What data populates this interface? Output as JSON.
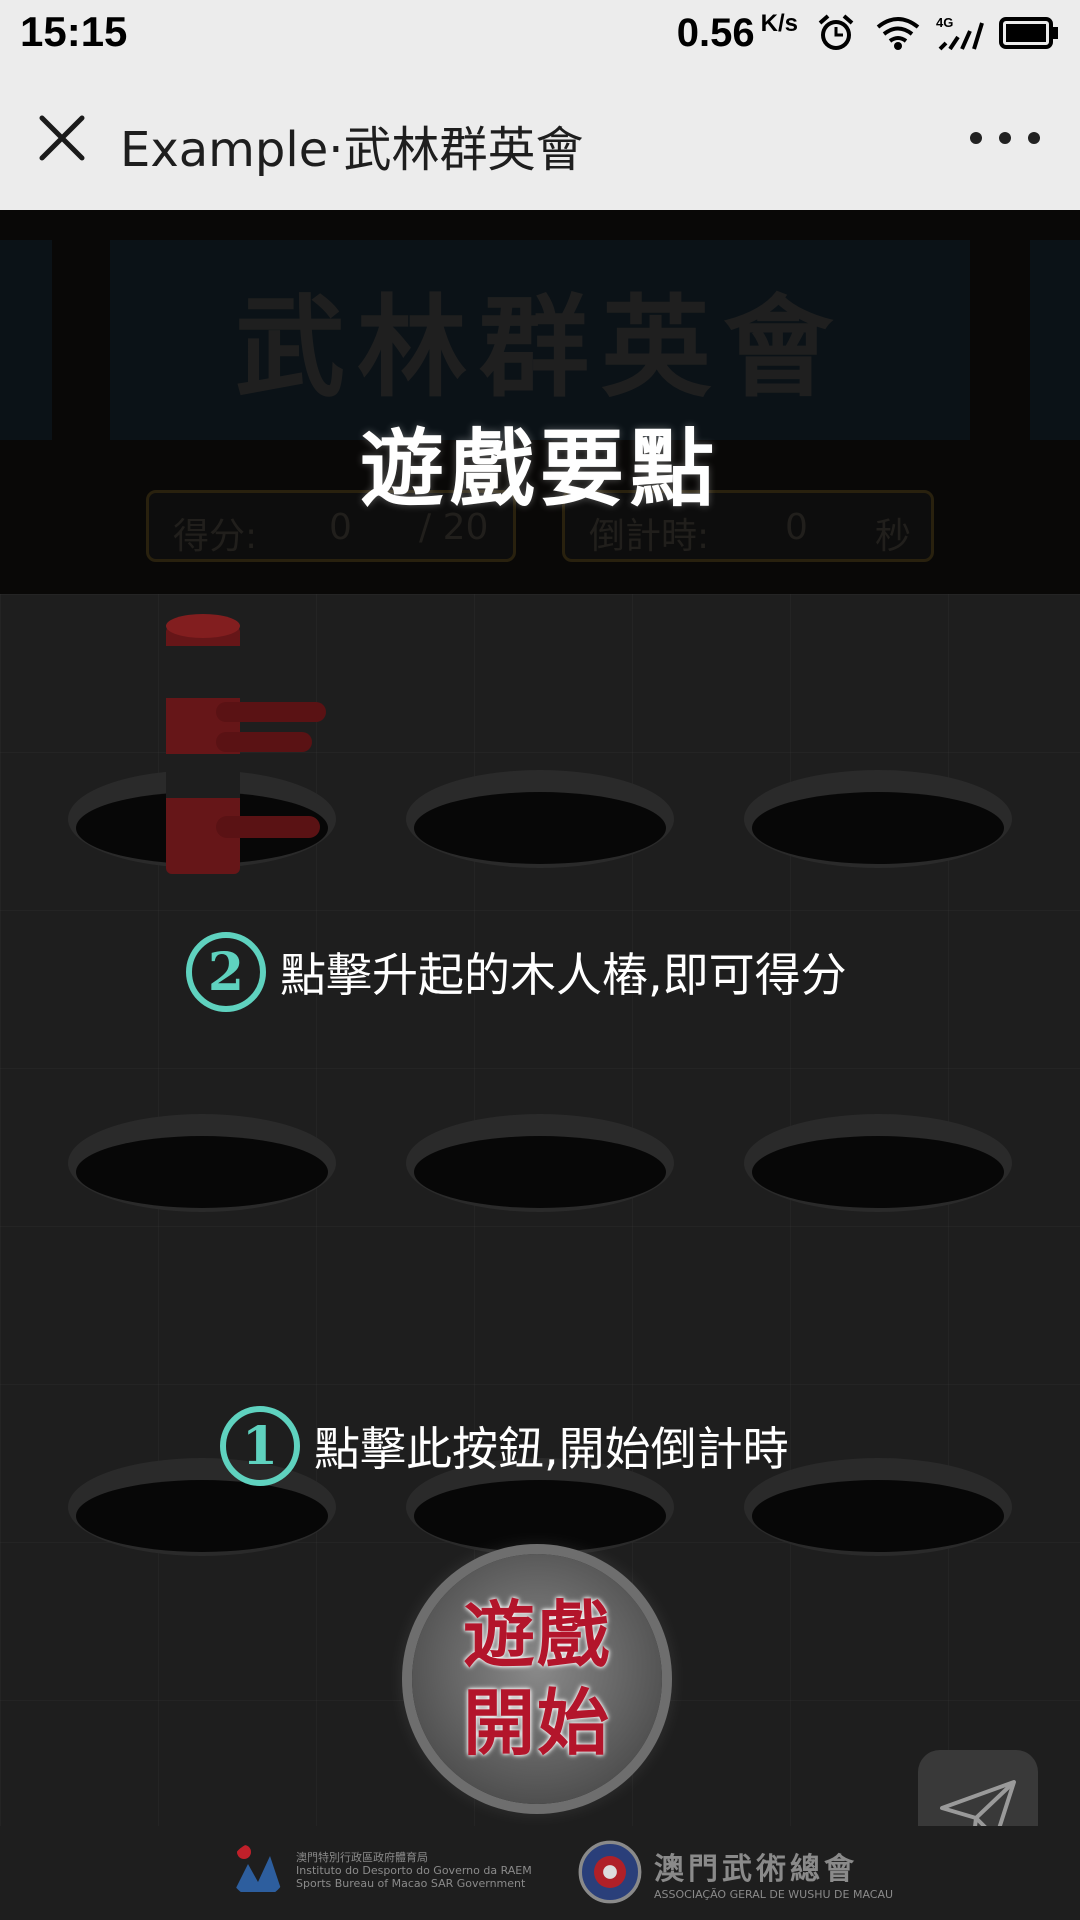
{
  "status_bar": {
    "time": "15:15",
    "net_speed": "0.56",
    "net_unit": "K/s",
    "icons": [
      "alarm-icon",
      "wifi-icon",
      "signal-4g-icon",
      "battery-icon"
    ]
  },
  "title_bar": {
    "title": "Example·武林群英會",
    "close_icon": "close-icon",
    "more_icon": "more-icon"
  },
  "game": {
    "bg_title": "武林群英會",
    "score_label": "得分:",
    "score_value": "0",
    "score_total": "/ 20",
    "timer_label": "倒計時:",
    "timer_value": "0",
    "timer_unit": "秒",
    "guide_title": "遊戲要點",
    "tip2_number": "2",
    "tip2_text": "點擊升起的木人樁,即可得分",
    "tip1_number": "1",
    "tip1_text": "點擊此按鈕,開始倒計時",
    "start_line1": "遊戲",
    "start_line2": "開始",
    "share_icon": "paper-plane-icon"
  },
  "footer": {
    "left_org": "澳門特別行政區政府體育局",
    "left_org_pt": "Instituto do Desporto do Governo da RAEM",
    "left_org_en": "Sports Bureau of Macao SAR Government",
    "right_org": "澳門武術總會",
    "right_org_pt": "ASSOCIAÇÃO GERAL DE WUSHU DE MACAU"
  },
  "colors": {
    "accent_teal": "#5fd2bf",
    "start_red": "#b3152b",
    "dummy_red": "#8e1f22"
  }
}
